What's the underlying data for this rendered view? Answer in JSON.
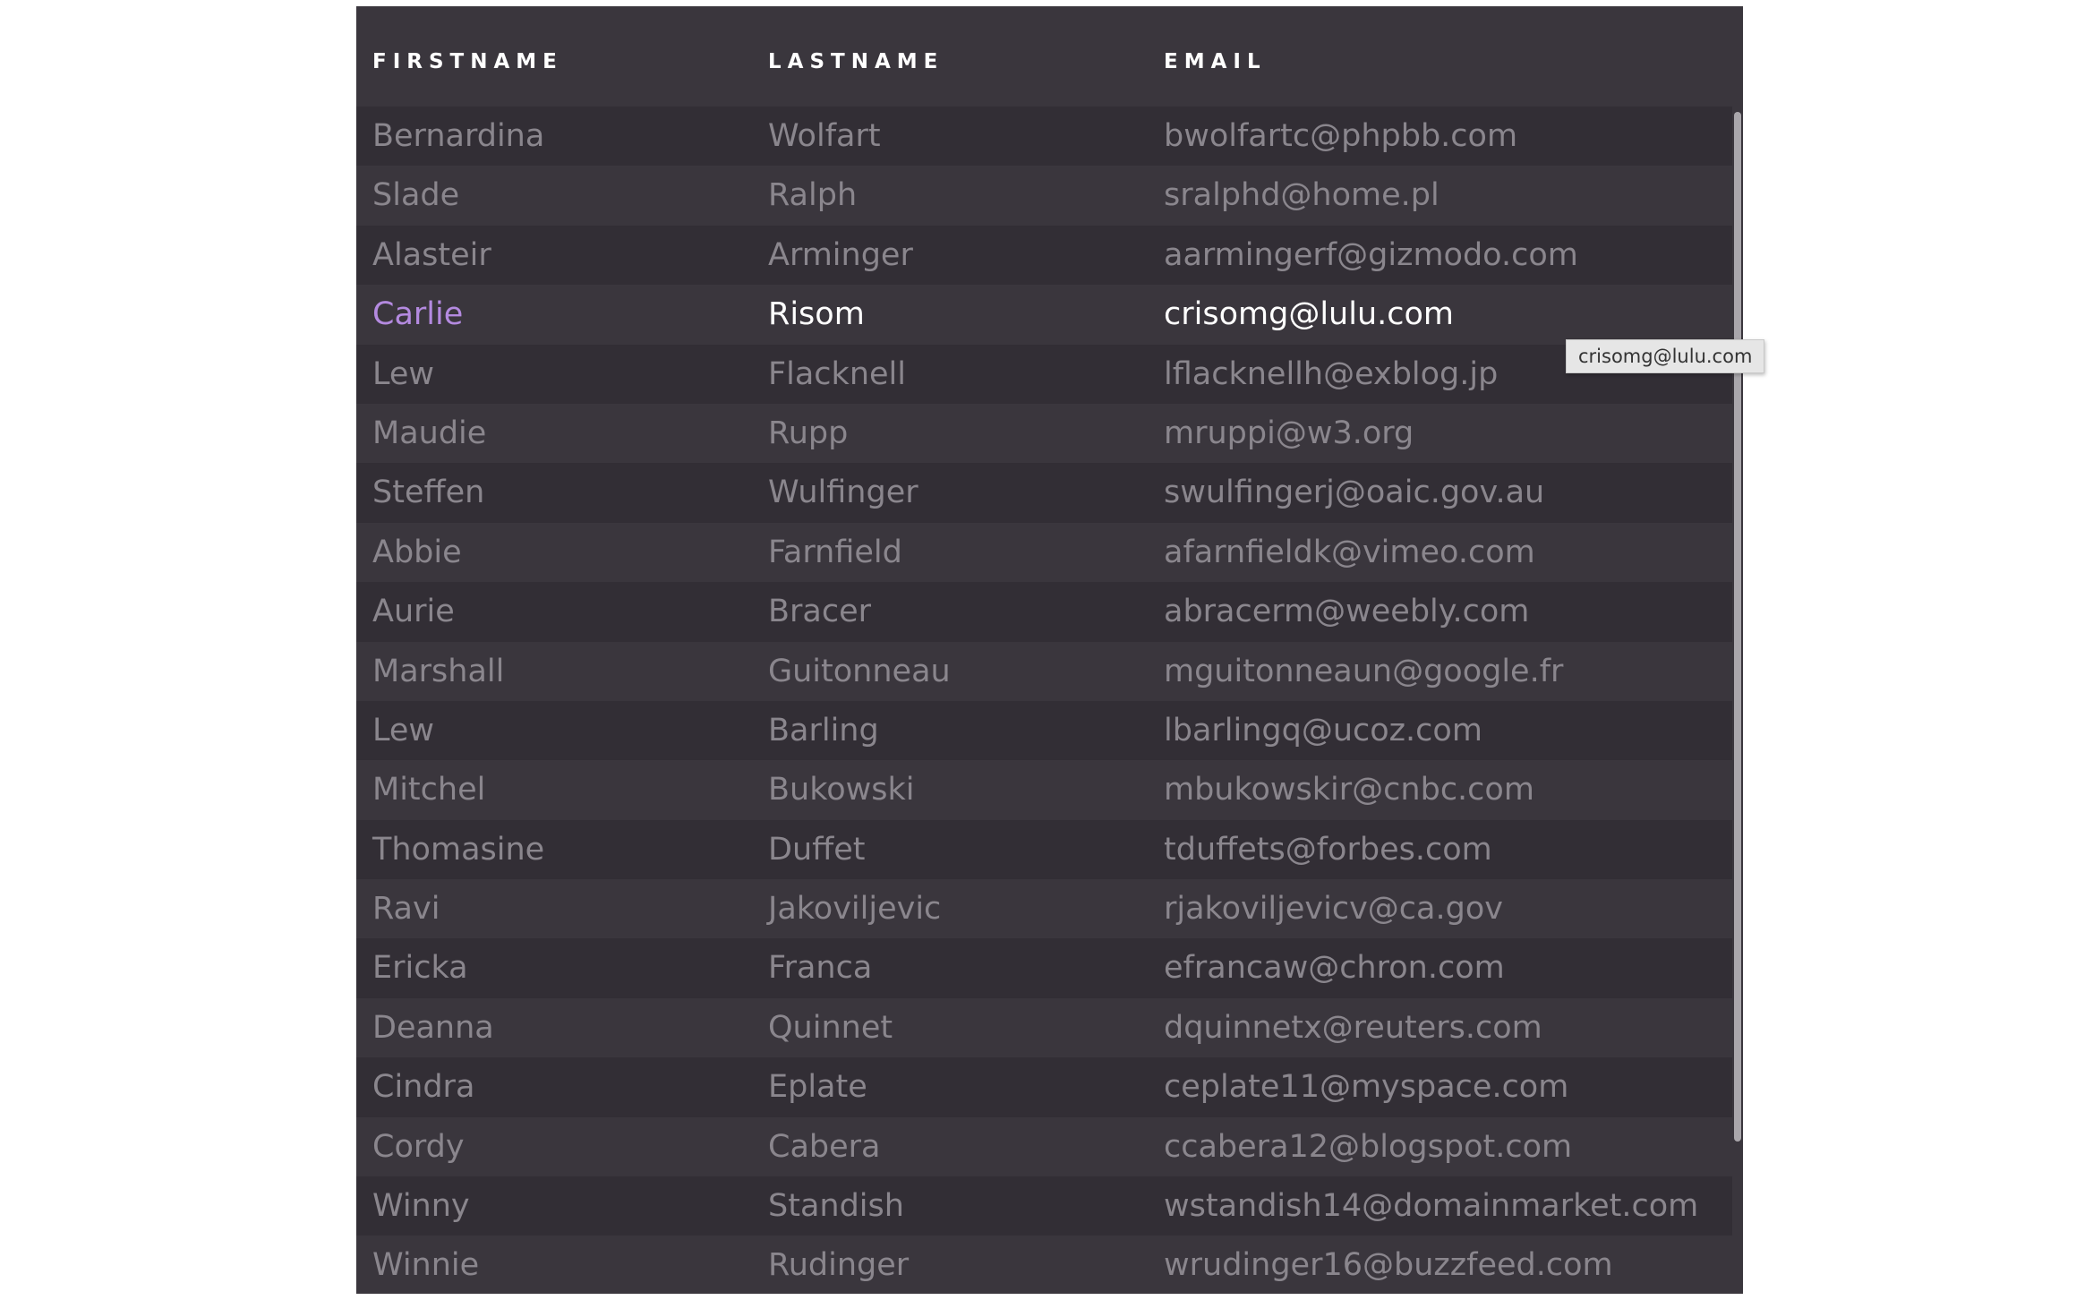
{
  "table": {
    "headers": [
      "FIRSTNAME",
      "LASTNAME",
      "EMAIL"
    ],
    "active_row": 3,
    "rows": [
      {
        "firstname": "Bernardina",
        "lastname": "Wolfart",
        "email": "bwolfartc@phpbb.com"
      },
      {
        "firstname": "Slade",
        "lastname": "Ralph",
        "email": "sralphd@home.pl"
      },
      {
        "firstname": "Alasteir",
        "lastname": "Arminger",
        "email": "aarmingerf@gizmodo.com"
      },
      {
        "firstname": "Carlie",
        "lastname": "Risom",
        "email": "crisomg@lulu.com"
      },
      {
        "firstname": "Lew",
        "lastname": "Flacknell",
        "email": "lflacknellh@exblog.jp"
      },
      {
        "firstname": "Maudie",
        "lastname": "Rupp",
        "email": "mruppi@w3.org"
      },
      {
        "firstname": "Steffen",
        "lastname": "Wulfinger",
        "email": "swulfingerj@oaic.gov.au"
      },
      {
        "firstname": "Abbie",
        "lastname": "Farnfield",
        "email": "afarnfieldk@vimeo.com"
      },
      {
        "firstname": "Aurie",
        "lastname": "Bracer",
        "email": "abracerm@weebly.com"
      },
      {
        "firstname": "Marshall",
        "lastname": "Guitonneau",
        "email": "mguitonneaun@google.fr"
      },
      {
        "firstname": "Lew",
        "lastname": "Barling",
        "email": "lbarlingq@ucoz.com"
      },
      {
        "firstname": "Mitchel",
        "lastname": "Bukowski",
        "email": "mbukowskir@cnbc.com"
      },
      {
        "firstname": "Thomasine",
        "lastname": "Duffet",
        "email": "tduffets@forbes.com"
      },
      {
        "firstname": "Ravi",
        "lastname": "Jakoviljevic",
        "email": "rjakoviljevicv@ca.gov"
      },
      {
        "firstname": "Ericka",
        "lastname": "Franca",
        "email": "efrancaw@chron.com"
      },
      {
        "firstname": "Deanna",
        "lastname": "Quinnet",
        "email": "dquinnetx@reuters.com"
      },
      {
        "firstname": "Cindra",
        "lastname": "Eplate",
        "email": "ceplate11@myspace.com"
      },
      {
        "firstname": "Cordy",
        "lastname": "Cabera",
        "email": "ccabera12@blogspot.com"
      },
      {
        "firstname": "Winny",
        "lastname": "Standish",
        "email": "wstandish14@domainmarket.com"
      },
      {
        "firstname": "Winnie",
        "lastname": "Rudinger",
        "email": "wrudinger16@buzzfeed.com"
      }
    ]
  },
  "tooltip": {
    "text": "crisomg@lulu.com"
  },
  "colors": {
    "background": "#3a363d",
    "row_alt": "#322e35",
    "text_muted": "#8a868d",
    "text_active": "#ffffff",
    "accent": "#b48ae0"
  }
}
